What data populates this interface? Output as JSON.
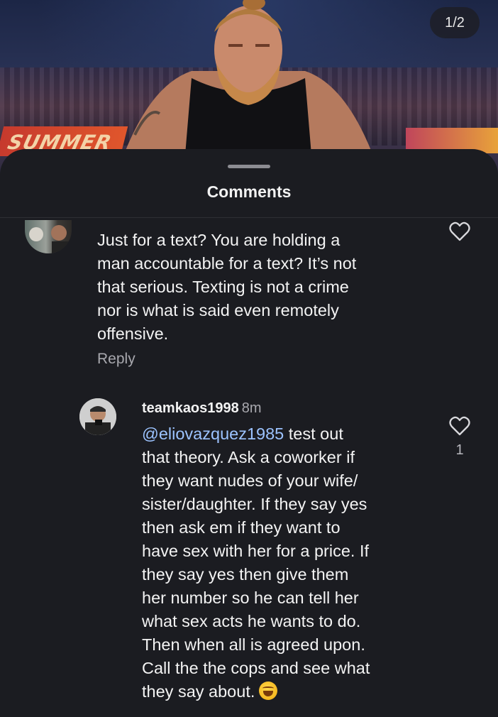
{
  "header": {
    "image_counter": "1/2",
    "sign_text": "SUMMER"
  },
  "sheet": {
    "title": "Comments"
  },
  "comments": [
    {
      "text": "Just for a text? You are holding a man accountable for a text? It’s not that serious. Texting is not a crime nor is what is said even remotely offensive.",
      "lines": [
        "Just for a text? You are holding a",
        "man accountable for a text? It’s not",
        "that serious. Texting is not a crime",
        "nor is what is said even remotely",
        "offensive."
      ],
      "reply_label": "Reply"
    },
    {
      "username": "teamkaos1998",
      "time": "8m",
      "mention": "@eliovazquez1985",
      "lines": [
        " test out",
        "that theory.  Ask a coworker if",
        "they want nudes  of your wife/",
        "sister/daughter.  If they say yes",
        "then ask em if they want to",
        "have sex with her for a price.  If",
        "they say yes then give them",
        "her number so he can tell her",
        "what sex acts he wants to do.",
        "Then when all is agreed upon.",
        "Call the the cops and see what",
        "they say about."
      ],
      "emoji": "grinning-sweat-emoji",
      "like_count": "1"
    }
  ],
  "colors": {
    "background": "#1b1c21",
    "text": "#f3f3f3",
    "secondary_text": "#a8a8ae",
    "mention": "#9cc3ff"
  },
  "icons": [
    "heart-icon",
    "avatar"
  ]
}
